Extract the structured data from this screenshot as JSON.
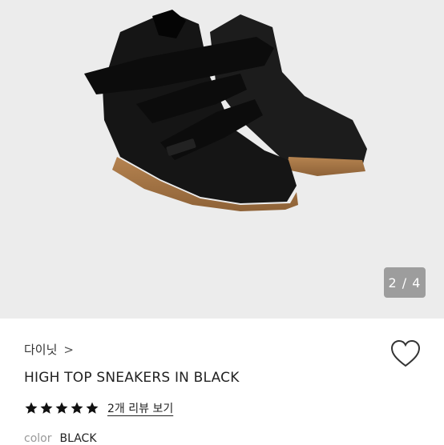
{
  "gallery": {
    "counter": "2 / 4",
    "image": "black-suede-high-top-sneakers"
  },
  "product": {
    "brand": "다이닛",
    "brand_chevron": ">",
    "title": "HIGH TOP SNEAKERS IN BLACK",
    "rating_stars": 5,
    "review_link": "2개 리뷰 보기",
    "color_label": "color",
    "color_value": "BLACK",
    "wishlist_icon": "heart-outline-icon"
  },
  "colors": {
    "star": "#111111",
    "background_gallery": "#ececec",
    "counter_badge": "#9d9d9d"
  }
}
